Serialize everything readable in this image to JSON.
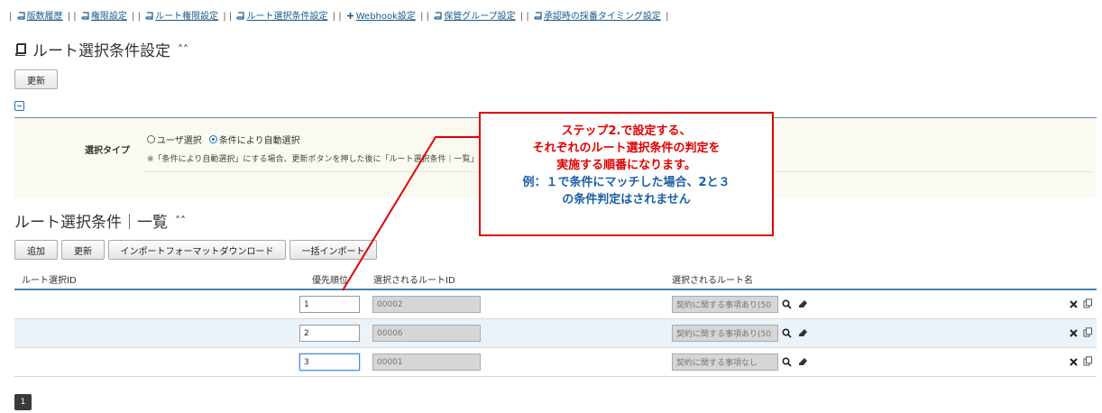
{
  "nav": {
    "items": [
      "版数履歴",
      "権限設定",
      "ルート権限設定",
      "ルート選択条件設定",
      "Webhook設定",
      "保管グループ設定",
      "承認時の採番タイミング設定"
    ]
  },
  "page": {
    "title": "ルート選択条件設定",
    "update_label": "更新"
  },
  "select_type": {
    "label": "選択タイプ",
    "option_user": "ユーザ選択",
    "option_auto": "条件により自動選択",
    "note": "※「条件により自動選択」にする場合、更新ボタンを押した後に「ルート選択条件｜一覧」"
  },
  "list": {
    "title": "ルート選択条件｜一覧",
    "buttons": {
      "add": "追加",
      "update": "更新",
      "import_format": "インポートフォーマットダウンロード",
      "bulk_import": "一括インポート"
    },
    "columns": {
      "route_id": "ルート選択ID",
      "priority": "優先順位",
      "selected_route_id": "選択されるルートID",
      "selected_route_name": "選択されるルート名"
    },
    "rows": [
      {
        "priority": "1",
        "route_id": "00002",
        "route_name": "契約に関する事項あり(50"
      },
      {
        "priority": "2",
        "route_id": "00006",
        "route_name": "契約に関する事項あり(50"
      },
      {
        "priority": "3",
        "route_id": "00001",
        "route_name": "契約に関する事項なし"
      }
    ]
  },
  "pagination": {
    "current": "1"
  },
  "callout": {
    "line1": "ステップ2.で設定する、",
    "line2": "それぞれのルート選択条件の判定を",
    "line3": "実施する順番になります。",
    "line4": "例：１で条件にマッチした場合、2と３",
    "line5": "の条件判定はされません"
  },
  "colors": {
    "accent_red": "#e00000",
    "link_blue": "#1a5a8a",
    "callout_blue": "#1a5fa8"
  }
}
